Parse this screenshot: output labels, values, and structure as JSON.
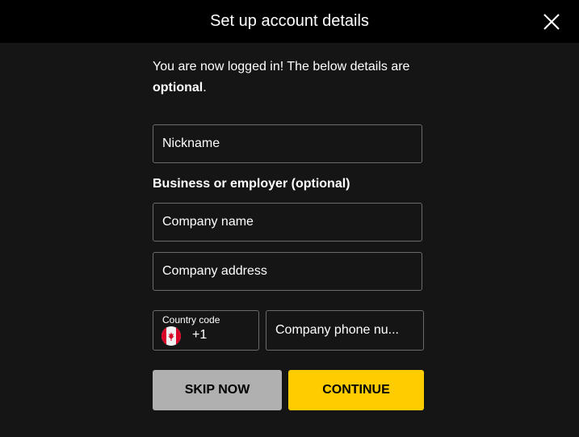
{
  "header": {
    "title": "Set up account details",
    "close_icon": "close-icon"
  },
  "intro": {
    "text": "You are now logged in! The below details are ",
    "bold": "optional",
    "suffix": "."
  },
  "fields": {
    "nickname": {
      "placeholder": "Nickname",
      "value": ""
    },
    "section_label": "Business or employer (optional)",
    "company_name": {
      "placeholder": "Company name",
      "value": ""
    },
    "company_address": {
      "placeholder": "Company address",
      "value": ""
    },
    "country_code": {
      "label": "Country code",
      "flag": "canada-flag-icon",
      "value": "+1"
    },
    "company_phone": {
      "placeholder": "Company phone nu...",
      "value": ""
    }
  },
  "buttons": {
    "skip": "SKIP NOW",
    "continue": "CONTINUE"
  },
  "colors": {
    "background": "#151515",
    "header": "#000000",
    "skip_button": "#b0b0b0",
    "continue_button": "#ffcc00"
  }
}
